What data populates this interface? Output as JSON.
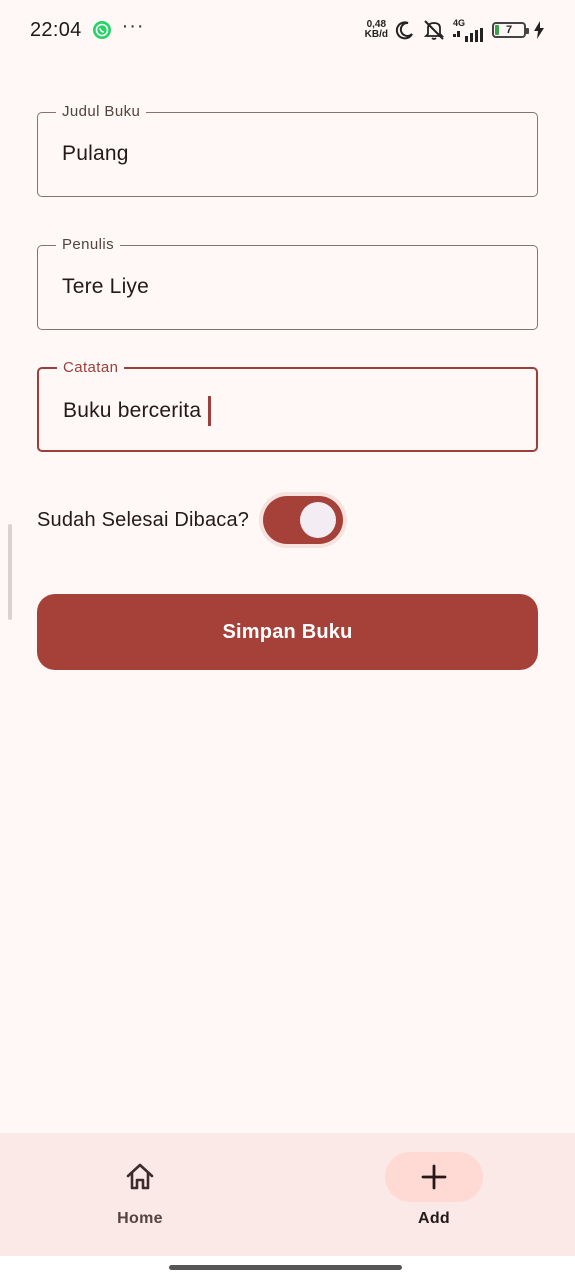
{
  "status_bar": {
    "time": "22:04",
    "more": "···",
    "speed_value": "0,48",
    "speed_unit": "KB/d",
    "network": "4G",
    "battery": "7",
    "icons": [
      "whatsapp-icon",
      "moon-icon",
      "mute-icon",
      "signal-icon",
      "battery-icon",
      "charging-icon"
    ]
  },
  "form": {
    "title_field": {
      "label": "Judul Buku",
      "value": "Pulang"
    },
    "author_field": {
      "label": "Penulis",
      "value": "Tere Liye"
    },
    "notes_field": {
      "label": "Catatan",
      "value": "Buku bercerita"
    },
    "finished_switch": {
      "label": "Sudah Selesai Dibaca?",
      "checked": true
    },
    "save_label": "Simpan Buku"
  },
  "bottom_nav": {
    "items": [
      {
        "label": "Home",
        "icon": "home-icon",
        "selected": false
      },
      {
        "label": "Add",
        "icon": "plus-icon",
        "selected": true
      }
    ]
  },
  "colors": {
    "primary": "#a6413a",
    "background": "#fff8f6",
    "nav_background": "#fbe9e7",
    "nav_indicator": "#ffd9d4",
    "outline": "#857371"
  }
}
